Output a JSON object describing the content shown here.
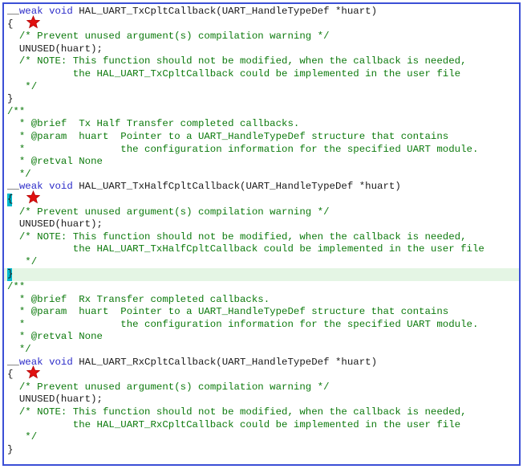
{
  "colors": {
    "keyword": "#2c2cc9",
    "comment": "#0d7a0d",
    "text": "#1a1a1a",
    "border": "#3b4fd6",
    "star": "#e01010",
    "highlight": "#e4f5e4"
  },
  "lines": [
    {
      "segs": [
        [
          "plain",
          "__"
        ],
        [
          "kw",
          "weak"
        ],
        [
          "plain",
          " "
        ],
        [
          "kw",
          "void"
        ],
        [
          "plain",
          " HAL_UART_TxCpltCallback(UART_HandleTypeDef *huart)"
        ]
      ]
    },
    {
      "segs": [
        [
          "plain",
          "{"
        ]
      ],
      "star": true
    },
    {
      "segs": [
        [
          "plain",
          "  "
        ],
        [
          "cmt",
          "/* Prevent unused argument(s) compilation warning */"
        ]
      ]
    },
    {
      "segs": [
        [
          "plain",
          "  UNUSED(huart);"
        ]
      ]
    },
    {
      "segs": [
        [
          "plain",
          "  "
        ],
        [
          "cmt",
          "/* NOTE: This function should not be modified, when the callback is needed,"
        ]
      ]
    },
    {
      "segs": [
        [
          "cmt",
          "           the HAL_UART_TxCpltCallback could be implemented in the user file"
        ]
      ]
    },
    {
      "segs": [
        [
          "cmt",
          "   */"
        ]
      ]
    },
    {
      "segs": [
        [
          "plain",
          "}"
        ]
      ]
    },
    {
      "segs": [
        [
          "cmt",
          "/**"
        ]
      ]
    },
    {
      "segs": [
        [
          "cmt",
          "  * @brief  Tx Half Transfer completed callbacks."
        ]
      ]
    },
    {
      "segs": [
        [
          "cmt",
          "  * @param  huart  Pointer to a UART_HandleTypeDef structure that contains"
        ]
      ]
    },
    {
      "segs": [
        [
          "cmt",
          "  *                the configuration information for the specified UART module."
        ]
      ]
    },
    {
      "segs": [
        [
          "cmt",
          "  * @retval None"
        ]
      ]
    },
    {
      "segs": [
        [
          "cmt",
          "  */"
        ]
      ]
    },
    {
      "segs": [
        [
          "plain",
          "__"
        ],
        [
          "kw",
          "weak"
        ],
        [
          "plain",
          " "
        ],
        [
          "kw",
          "void"
        ],
        [
          "plain",
          " HAL_UART_TxHalfCpltCallback(UART_HandleTypeDef *huart)"
        ]
      ]
    },
    {
      "segs": [
        [
          "brace",
          "{"
        ]
      ],
      "star": true
    },
    {
      "segs": [
        [
          "plain",
          "  "
        ],
        [
          "cmt",
          "/* Prevent unused argument(s) compilation warning */"
        ]
      ]
    },
    {
      "segs": [
        [
          "plain",
          "  UNUSED(huart);"
        ]
      ]
    },
    {
      "segs": [
        [
          "plain",
          "  "
        ],
        [
          "cmt",
          "/* NOTE: This function should not be modified, when the callback is needed,"
        ]
      ]
    },
    {
      "segs": [
        [
          "cmt",
          "           the HAL_UART_TxHalfCpltCallback could be implemented in the user file"
        ]
      ]
    },
    {
      "segs": [
        [
          "cmt",
          "   */"
        ]
      ]
    },
    {
      "segs": [
        [
          "brace",
          "}"
        ]
      ],
      "hl": true
    },
    {
      "segs": [
        [
          "cmt",
          "/**"
        ]
      ]
    },
    {
      "segs": [
        [
          "cmt",
          "  * @brief  Rx Transfer completed callbacks."
        ]
      ]
    },
    {
      "segs": [
        [
          "cmt",
          "  * @param  huart  Pointer to a UART_HandleTypeDef structure that contains"
        ]
      ]
    },
    {
      "segs": [
        [
          "cmt",
          "  *                the configuration information for the specified UART module."
        ]
      ]
    },
    {
      "segs": [
        [
          "cmt",
          "  * @retval None"
        ]
      ]
    },
    {
      "segs": [
        [
          "cmt",
          "  */"
        ]
      ]
    },
    {
      "segs": [
        [
          "plain",
          "__"
        ],
        [
          "kw",
          "weak"
        ],
        [
          "plain",
          " "
        ],
        [
          "kw",
          "void"
        ],
        [
          "plain",
          " HAL_UART_RxCpltCallback(UART_HandleTypeDef *huart)"
        ]
      ]
    },
    {
      "segs": [
        [
          "plain",
          "{"
        ]
      ],
      "star": true
    },
    {
      "segs": [
        [
          "plain",
          "  "
        ],
        [
          "cmt",
          "/* Prevent unused argument(s) compilation warning */"
        ]
      ]
    },
    {
      "segs": [
        [
          "plain",
          "  UNUSED(huart);"
        ]
      ]
    },
    {
      "segs": [
        [
          "plain",
          "  "
        ],
        [
          "cmt",
          "/* NOTE: This function should not be modified, when the callback is needed,"
        ]
      ]
    },
    {
      "segs": [
        [
          "cmt",
          "           the HAL_UART_RxCpltCallback could be implemented in the user file"
        ]
      ]
    },
    {
      "segs": [
        [
          "cmt",
          "   */"
        ]
      ]
    },
    {
      "segs": [
        [
          "plain",
          "}"
        ]
      ]
    }
  ]
}
